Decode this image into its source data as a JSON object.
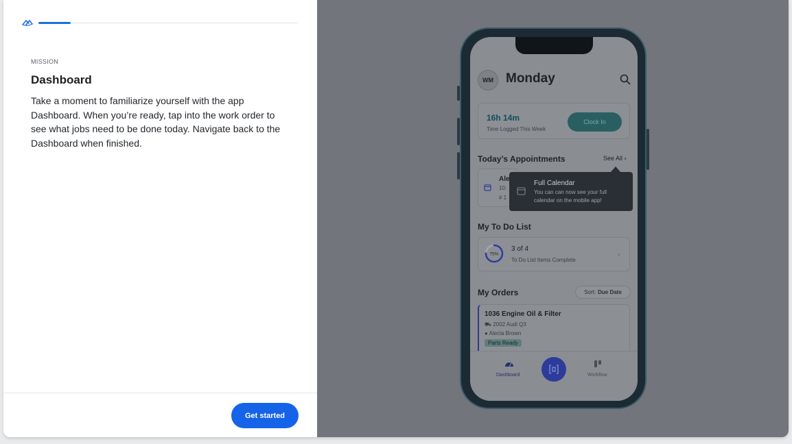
{
  "onboarding": {
    "eyebrow": "MISSION",
    "title": "Dashboard",
    "description": "Take a moment to familiarize yourself with the app Dashboard. When you’re ready, tap into the work order to see what jobs need to be done today. Navigate back to the Dashboard when finished.",
    "cta_label": "Get started",
    "progress_fraction": 0.125,
    "accent_color": "#1563e8"
  },
  "phone": {
    "avatar_initials": "WM",
    "day": "Monday",
    "time_logged": {
      "value": "16h 14m",
      "label": "Time Logged This Week",
      "button": "Clock In"
    },
    "appointments": {
      "title": "Today’s Appointments",
      "see_all": "See All",
      "name_partial": "Ale",
      "time_partial": "10:",
      "number_partial": "# 1"
    },
    "tooltip": {
      "title": "Full Calendar",
      "text": "You can can now see your full calendar on the mobile app!"
    },
    "todo": {
      "title": "My To Do List",
      "percent": "75%",
      "count": "3 of 4",
      "label": "To Do List Items Complete"
    },
    "orders": {
      "title": "My Orders",
      "sort_prefix": "Sort:",
      "sort_value": "Due Date",
      "item": {
        "title": "1036 Engine Oil & Filter",
        "car": "2002 Audi Q3",
        "person": "Alecia Brown",
        "badge": "Parts Ready"
      }
    },
    "tabs": {
      "dashboard": "Dashboard",
      "workflow": "Workflow"
    }
  }
}
